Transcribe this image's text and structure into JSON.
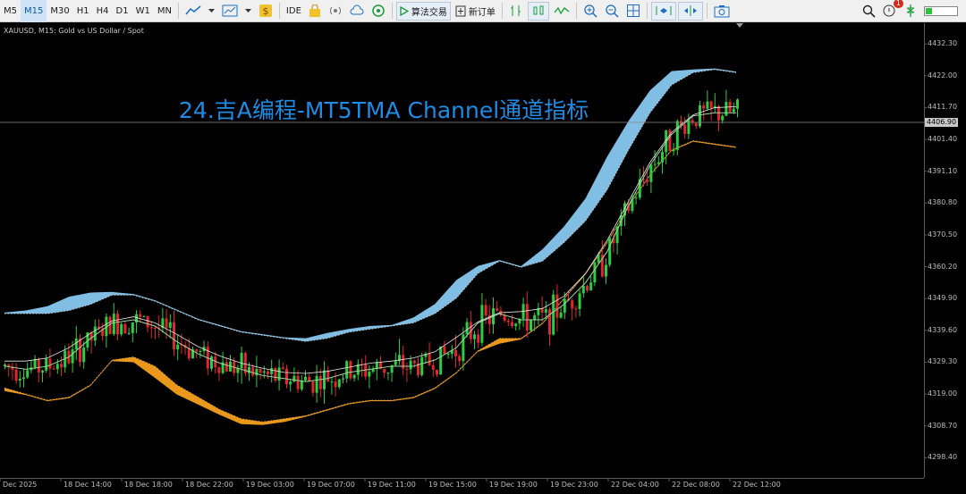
{
  "toolbar": {
    "timeframes": [
      "M5",
      "M15",
      "M30",
      "H1",
      "H4",
      "D1",
      "W1",
      "MN"
    ],
    "active_timeframe": "M15",
    "ide_label": "IDE",
    "algo_label": "算法交易",
    "new_order_label": "新订单",
    "notification_count": "1",
    "battery_level": 0.2,
    "icons": [
      "line-chart-icon",
      "dropdown-icon",
      "chart-type-icon",
      "dropdown-icon",
      "dollar-icon",
      "ide-icon",
      "bag-icon",
      "signal-icon",
      "cloud-icon",
      "vps-icon",
      "play-icon",
      "new-order-icon",
      "depth-icon",
      "candle-icon",
      "wave-icon",
      "zoom-in-icon",
      "zoom-out-icon",
      "grid-icon",
      "autoscroll-icon",
      "chart-shift-icon",
      "screenshot-icon",
      "search-icon",
      "notification-icon",
      "signal-strength-icon",
      "battery-icon"
    ]
  },
  "chart": {
    "symbol_label": "XAUUSD, M15:  Gold vs US Dollar / Spot",
    "overlay_title": "24.吉A编程-MT5TMA Channel通道指标",
    "current_price": "4406.90",
    "colors": {
      "background": "#000000",
      "bull": "#2ecc40",
      "bear": "#e0262e",
      "upper_fill": "#87c8f0",
      "lower_fill": "#f5a01e",
      "center_line": "#9fd6a0",
      "ma_line": "#e8e8e8",
      "title": "#1e8be4"
    }
  },
  "chart_data": {
    "type": "line",
    "title": "24.吉A编程-MT5TMA Channel通道指标",
    "price_ticks": [
      "4432.30",
      "4422.00",
      "4411.70",
      "4401.40",
      "4391.10",
      "4380.80",
      "4370.50",
      "4360.20",
      "4349.90",
      "4339.60",
      "4329.30",
      "4319.00",
      "4308.70",
      "4298.40"
    ],
    "time_ticks": [
      "Dec 2025",
      "18 Dec 14:00",
      "18 Dec 18:00",
      "18 Dec 22:00",
      "19 Dec 03:00",
      "19 Dec 07:00",
      "19 Dec 11:00",
      "19 Dec 15:00",
      "19 Dec 19:00",
      "19 Dec 23:00",
      "22 Dec 04:00",
      "22 Dec 08:00",
      "22 Dec 12:00"
    ],
    "ylim": [
      4293,
      4439
    ],
    "current_price": 4406.9,
    "series": [
      {
        "values": [
          4328,
          4327,
          4328,
          4331,
          4337,
          4342,
          4343,
          4341,
          4336,
          4332,
          4329,
          4327,
          4325,
          4324,
          4323,
          4324,
          4326,
          4327,
          4328,
          4328,
          4330,
          4334,
          4342,
          4345,
          4343,
          4343,
          4348,
          4355,
          4365,
          4380,
          4393,
          4403,
          4409,
          4410,
          4410
        ]
      },
      {
        "name": "upper",
        "values": [
          4345,
          4345,
          4345,
          4346,
          4348,
          4351,
          4351,
          4349,
          4346,
          4343,
          4341,
          4339,
          4338,
          4337,
          4336,
          4337,
          4339,
          4340,
          4341,
          4342,
          4345,
          4350,
          4358,
          4362,
          4360,
          4362,
          4368,
          4375,
          4385,
          4398,
          4410,
          4419,
          4423,
          4424,
          4423
        ]
      },
      {
        "name": "lower",
        "values": [
          4321,
          4319,
          4317,
          4318,
          4322,
          4330,
          4331,
          4328,
          4322,
          4318,
          4314,
          4311,
          4310,
          4311,
          4312,
          4314,
          4316,
          4317,
          4317,
          4318,
          4321,
          4326,
          4333,
          4337,
          4337,
          4342,
          4350,
          4358,
          4368,
          4380,
          4390,
          4398,
          4401,
          4400,
          4399
        ]
      }
    ]
  }
}
